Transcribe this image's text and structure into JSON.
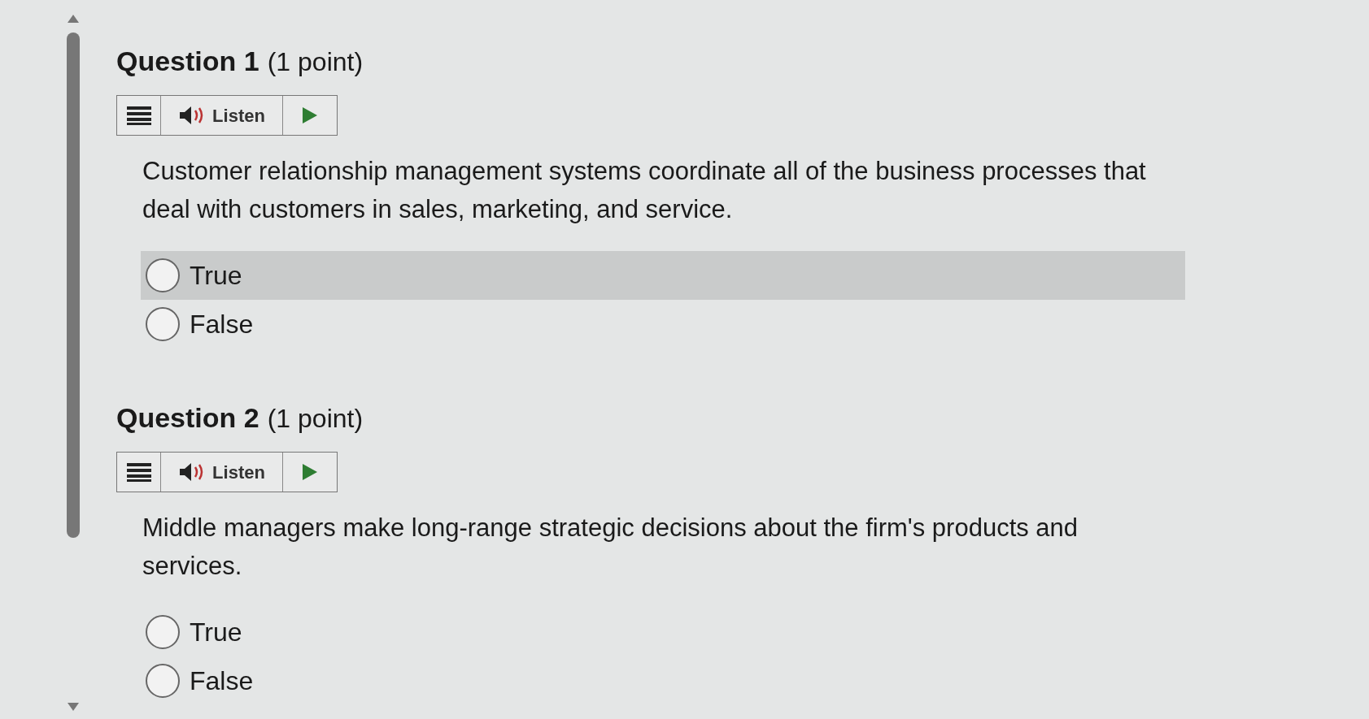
{
  "questions": [
    {
      "title": "Question 1",
      "points": "(1 point)",
      "listen": "Listen",
      "text": "Customer relationship management systems coordinate all of the business processes that deal with customers in sales, marketing, and service.",
      "options": [
        {
          "label": "True",
          "selected": false,
          "highlighted": true
        },
        {
          "label": "False",
          "selected": false,
          "highlighted": false
        }
      ]
    },
    {
      "title": "Question 2",
      "points": "(1 point)",
      "listen": "Listen",
      "text": "Middle managers make long-range strategic decisions about the firm's products and services.",
      "options": [
        {
          "label": "True",
          "selected": false,
          "highlighted": false
        },
        {
          "label": "False",
          "selected": false,
          "highlighted": false
        }
      ]
    }
  ]
}
